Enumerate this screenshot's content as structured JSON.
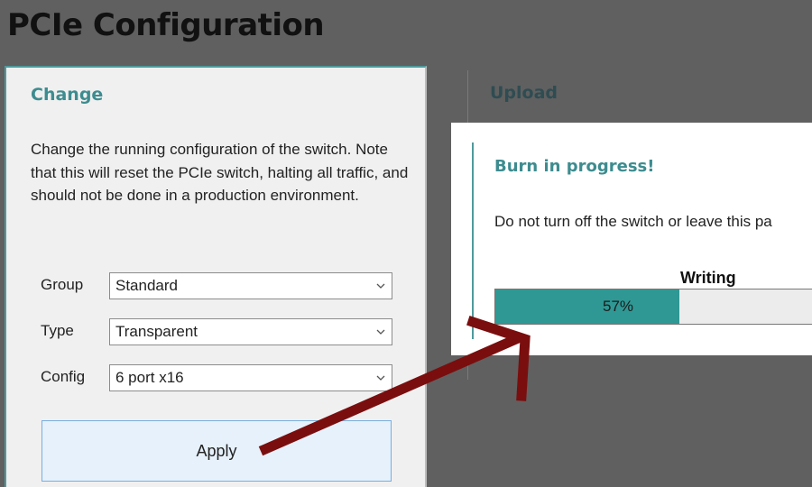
{
  "page": {
    "title": "PCIe Configuration"
  },
  "change": {
    "heading": "Change",
    "description": "Change the running configuration of the switch. Note that this will reset the PCIe switch, halting all traffic, and should not be done in a production environment.",
    "fields": [
      {
        "label": "Group",
        "value": "Standard"
      },
      {
        "label": "Type",
        "value": "Transparent"
      },
      {
        "label": "Config",
        "value": "6 port x16"
      }
    ],
    "apply_label": "Apply"
  },
  "upload": {
    "heading": "Upload"
  },
  "dialog": {
    "title": "Burn in progress!",
    "message": "Do not turn off the switch or leave this pa",
    "progress_label": "Writing",
    "progress_value": 0.57,
    "progress_text": "57%"
  },
  "colors": {
    "accent": "#3d8c8f",
    "progress_fill": "#2f9894",
    "annotation_arrow": "#7a0e0e"
  },
  "icons": {
    "select_chevron": "chevron-down-icon",
    "annotation": "arrow-annotation"
  }
}
